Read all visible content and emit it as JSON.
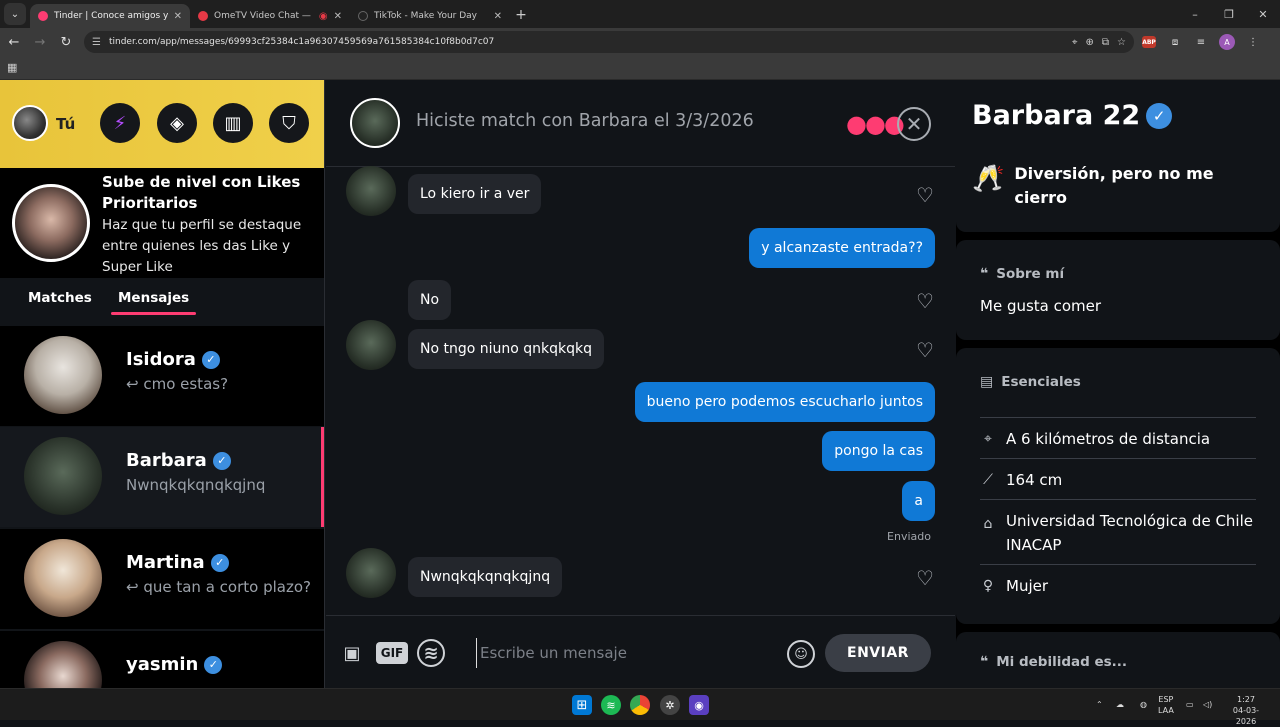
{
  "browser": {
    "tabs": [
      {
        "title": "Tinder | Conoce amigos y gente",
        "fav_color": "#fe3c72"
      },
      {
        "title": "OmeTV Video Chat — Ome",
        "fav_color": "#e63946"
      },
      {
        "title": "TikTok - Make Your Day",
        "fav_color": "#222222"
      }
    ],
    "url": "tinder.com/app/messages/69993cf25384c1a96307459569a761585384c10f8b0d7c07",
    "profile_initial": "A",
    "abp_label": "ABP"
  },
  "left": {
    "me_label": "Tú",
    "promo_title": "Sube de nivel con Likes Prioritarios",
    "promo_text": "Haz que tu perfil se destaque entre quienes les das Like y Super Like",
    "tab_matches": "Matches",
    "tab_messages": "Mensajes",
    "conversations": [
      {
        "name": "Isidora",
        "msg": "↩ cmo estas?"
      },
      {
        "name": "Barbara",
        "msg": "Nwnqkqkqnqkqjnq"
      },
      {
        "name": "Martina",
        "msg": "↩ que tan a corto plazo?"
      },
      {
        "name": "yasmin",
        "msg": ""
      }
    ]
  },
  "chat": {
    "header_title": "Hiciste match con Barbara el 3/3/2026",
    "messages": [
      {
        "dir": "in",
        "text": "Lo kiero ir a ver"
      },
      {
        "dir": "out",
        "text": "y alcanzaste entrada??"
      },
      {
        "dir": "in",
        "text": "No"
      },
      {
        "dir": "in",
        "text": "No tngo niuno qnkqkqkq"
      },
      {
        "dir": "out",
        "text": "bueno pero podemos escucharlo juntos"
      },
      {
        "dir": "out",
        "text": "pongo la cas"
      },
      {
        "dir": "out",
        "text": "a"
      },
      {
        "dir": "in",
        "text": "Nwnqkqkqnqkqjnq"
      }
    ],
    "sent_label": "Enviado",
    "gif_label": "GIF",
    "input_placeholder": "Escribe un mensaje",
    "send_label": "ENVIAR"
  },
  "profile": {
    "name": "Barbara 22",
    "intent": "Diversión, pero no me cierro",
    "about_title": "Sobre mí",
    "about_text": "Me gusta comer",
    "essentials_title": "Esenciales",
    "essentials": [
      "A 6 kilómetros de distancia",
      "164 cm",
      "Universidad Tecnológica de Chile INACAP",
      "Mujer"
    ],
    "weakness_title": "Mi debilidad es..."
  },
  "taskbar": {
    "lang_top": "ESP",
    "lang_bottom": "LAA",
    "time": "1:27",
    "date": "04-03-2026"
  },
  "colors": {
    "accent": "#fe3c72",
    "outgoing_bubble": "#1079d6",
    "verified": "#3d8fe0",
    "promo_yellow": "#f0d04a"
  }
}
